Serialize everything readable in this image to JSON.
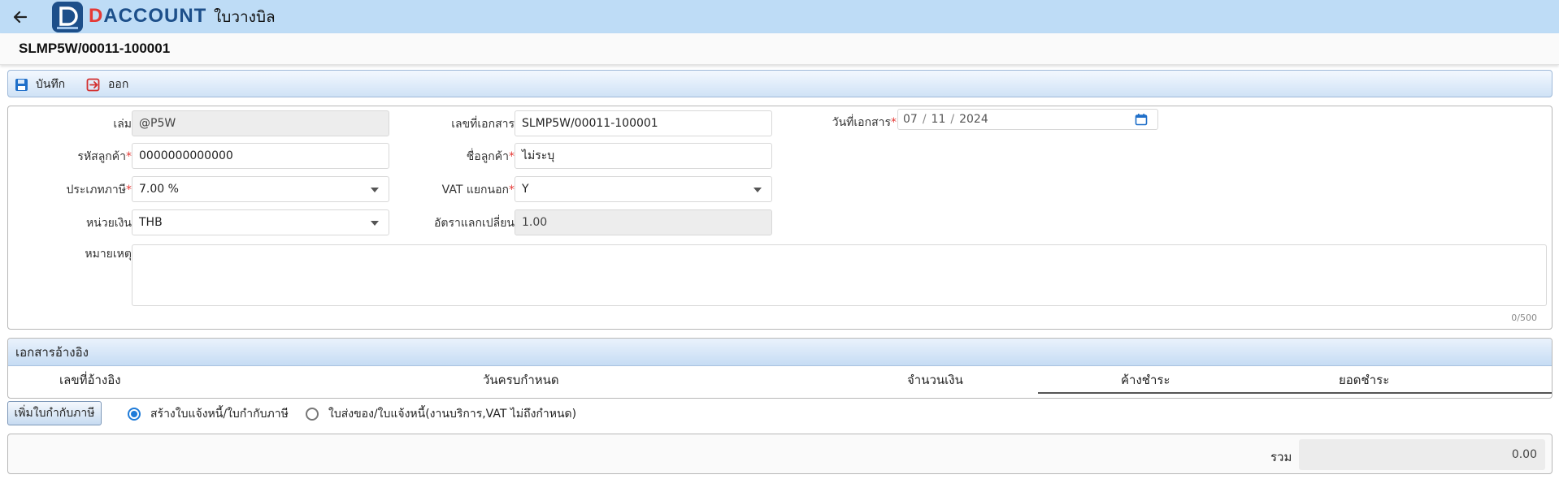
{
  "header": {
    "logo_letter": "D",
    "logo_text_rest": "ACCOUNT",
    "app_title": "ใบวางบิล"
  },
  "document": {
    "title": "SLMP5W/00011-100001"
  },
  "toolbar": {
    "save_label": "บันทึก",
    "exit_label": "ออก"
  },
  "form": {
    "book": {
      "label": "เล่ม",
      "value": "@P5W"
    },
    "doc_no": {
      "label": "เลขที่เอกสาร",
      "value": "SLMP5W/00011-100001"
    },
    "doc_date": {
      "label": "วันที่เอกสาร",
      "required_mark": "*",
      "day": "07",
      "month": "11",
      "year": "2024"
    },
    "customer_code": {
      "label": "รหัสลูกค้า",
      "required_mark": "*",
      "value": "0000000000000"
    },
    "customer_name": {
      "label": "ชื่อลูกค้า",
      "required_mark": "*",
      "value": "ไม่ระบุ"
    },
    "tax_type": {
      "label": "ประเภทภาษี",
      "required_mark": "*",
      "value": "7.00 %"
    },
    "vat_separate": {
      "label": "VAT แยกนอก",
      "required_mark": "*",
      "value": "Y"
    },
    "currency": {
      "label": "หน่วยเงิน",
      "value": "THB"
    },
    "exchange_rate": {
      "label": "อัตราแลกเปลี่ยน",
      "value": "1.00"
    },
    "remark": {
      "label": "หมายเหตุ",
      "value": "",
      "counter": "0/500"
    }
  },
  "reference": {
    "title": "เอกสารอ้างอิง",
    "columns": [
      "เลขที่อ้างอิง",
      "วันครบกำหนด",
      "จำนวนเงิน",
      "ค้างชำระ",
      "ยอดชำระ"
    ]
  },
  "actions": {
    "add_tax_invoice": "เพิ่มใบกำกับภาษี",
    "radio_create": "สร้างใบแจ้งหนี้/ใบกำกับภาษี",
    "radio_delivery": "ใบส่งของ/ใบแจ้งหนี้(งานบริการ,VAT ไม่ถึงกำหนด)",
    "selected": "radio_create"
  },
  "summary": {
    "label": "รวม",
    "total": "0.00"
  },
  "colors": {
    "header_bg": "#bedcf6",
    "brand_blue": "#1d4f8a",
    "brand_red": "#e53935",
    "accent": "#1f7bd8"
  }
}
